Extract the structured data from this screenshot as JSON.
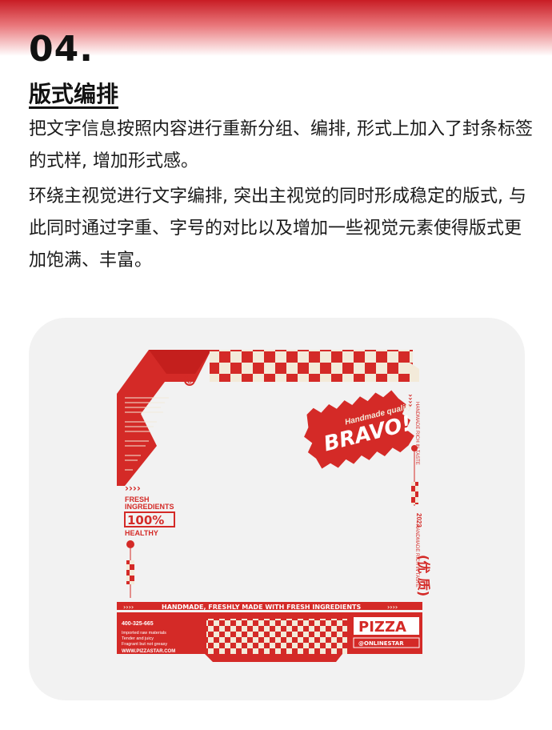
{
  "header": {
    "number": "04.",
    "title": "版式编排"
  },
  "body": {
    "paragraph_1": "把文字信息按照内容进行重新分组、编排, 形式上加入了封条标签的式样, 增加形式感。",
    "paragraph_2": "环绕主视觉进行文字编排, 突出主视觉的同时形成稳定的版式, 与此同时通过字重、字号的对比以及增加一些视觉元素使得版式更加饱满、丰富。"
  },
  "design": {
    "accent_color": "#d42a27",
    "cream_color": "#f3ead9",
    "badge_top": "Handmade quality",
    "badge_main": "BRAVO!",
    "fresh_line1": "FRESH",
    "fresh_line2": "INGREDIENTS",
    "percent": "100%",
    "healthy": "HEALTHY",
    "year": "2023",
    "quality_cn": "(优 质)",
    "right_top_text": "HANDMADE RICH IN TASTE",
    "right_mid_text": "HANDMADE RICH IN TASTE",
    "banner_text": "HANDMADE, FRESHLY MADE WITH FRESH INGREDIENTS",
    "phone": "400-325-665",
    "bullets": [
      "Imported raw materials",
      "Tender and juicy",
      "Fragrant but not greasy"
    ],
    "website": "WWW.PIZZASTAR.COM",
    "brand": "PIZZA",
    "brand_sub": "@ONLINESTAR",
    "corner_mark": "C",
    "tag_chevrons": "››››"
  }
}
